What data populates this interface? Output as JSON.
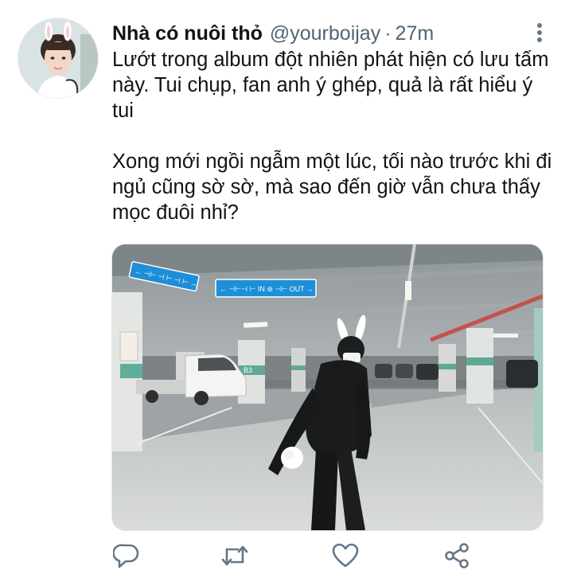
{
  "tweet": {
    "display_name": "Nhà có nuôi thỏ",
    "handle": "@yourboijay",
    "separator": "·",
    "timestamp": "27m",
    "text": "Lướt trong album đột nhiên phát hiện có lưu tấm này. Tui chụp, fan anh ý ghép, quả là rất hiểu ý tui\n\nXong mới ngồi ngẫm một lúc, tối nào trước khi đi ngủ cũng sờ sờ, mà sao đến giờ vẫn chưa thấy mọc đuôi nhỉ?"
  },
  "media": {
    "signs": [
      "←  ⊣⊢ ⊣ ⊢ ⊣ ⊢ →",
      "←  ⊣⊢⊣ ⊢ IN ⊚ ⊣⊢ OUT →"
    ],
    "pillar_label": "B3"
  },
  "icons": {
    "avatar": "avatar-photo",
    "more": "vertical-dots-icon",
    "reply": "reply-icon",
    "retweet": "retweet-icon",
    "like": "heart-icon",
    "share": "share-icon"
  },
  "colors": {
    "text_primary": "#0f1419",
    "text_secondary": "#536471",
    "icon_gray": "#657786",
    "sign_blue": "#1d8fd8"
  }
}
